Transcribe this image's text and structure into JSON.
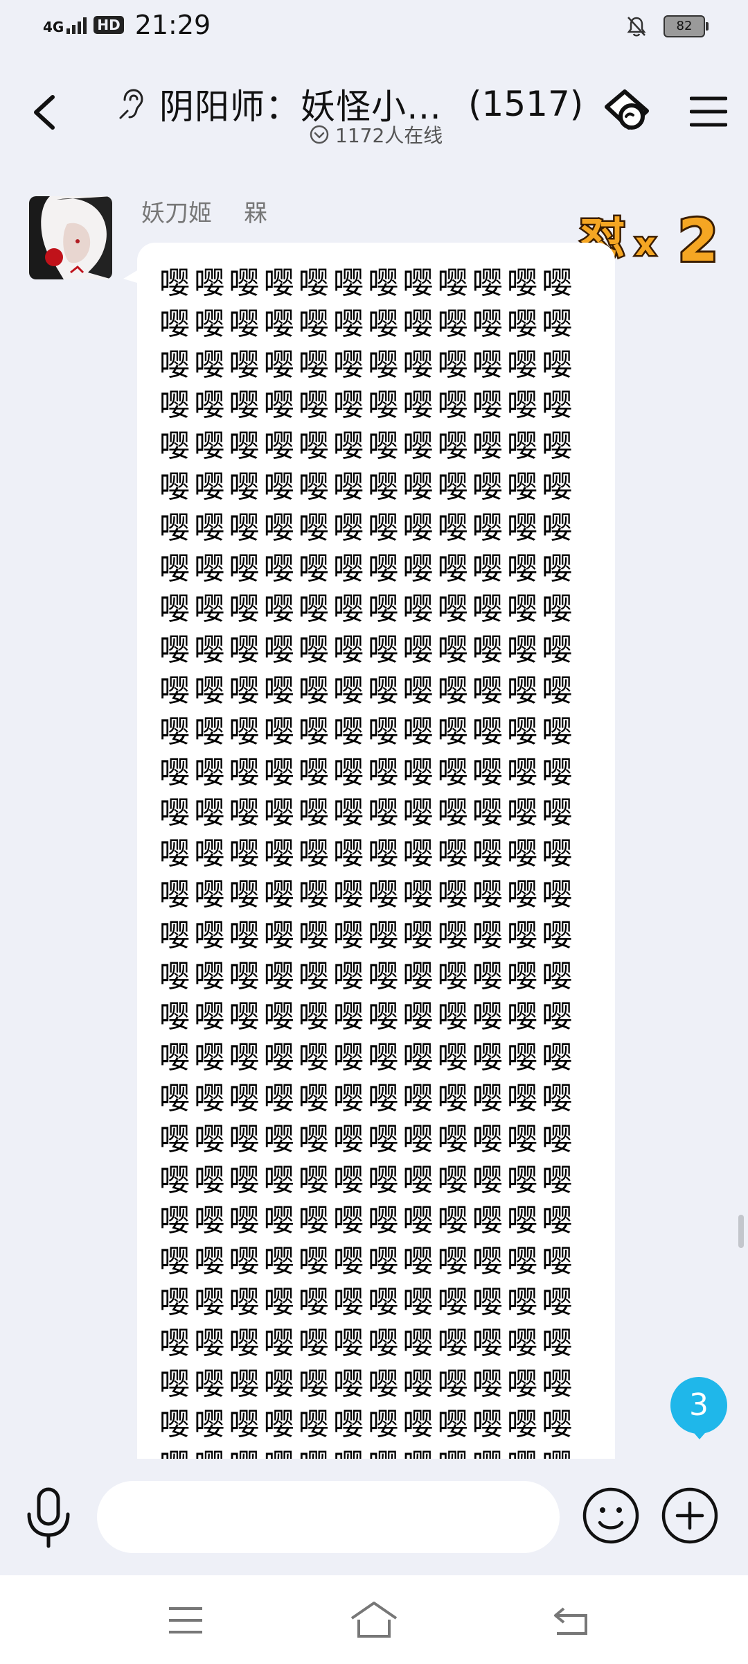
{
  "status_bar": {
    "network": "4G",
    "hd": "HD",
    "time": "21:29",
    "battery": "82",
    "icons": [
      "signal-icon",
      "bell-off-icon",
      "battery-icon"
    ]
  },
  "header": {
    "title": "阴阳师：妖怪小…",
    "member_count": "(1517)",
    "online_text": "1172人在线",
    "icons": [
      "back-icon",
      "ear-icon",
      "chat-bubble-icon",
      "menu-icon"
    ]
  },
  "message": {
    "sender_name": "妖刀姬",
    "sender_tag": "槑",
    "badge_glyph": "怼",
    "badge_x": "x",
    "badge_count": "2",
    "repeat_char": "嘤",
    "char_count": 372
  },
  "unread_count": "3",
  "input": {
    "placeholder": "",
    "value": ""
  },
  "nav": {
    "icons": [
      "nav-menu-icon",
      "nav-home-icon",
      "nav-back-icon"
    ]
  }
}
